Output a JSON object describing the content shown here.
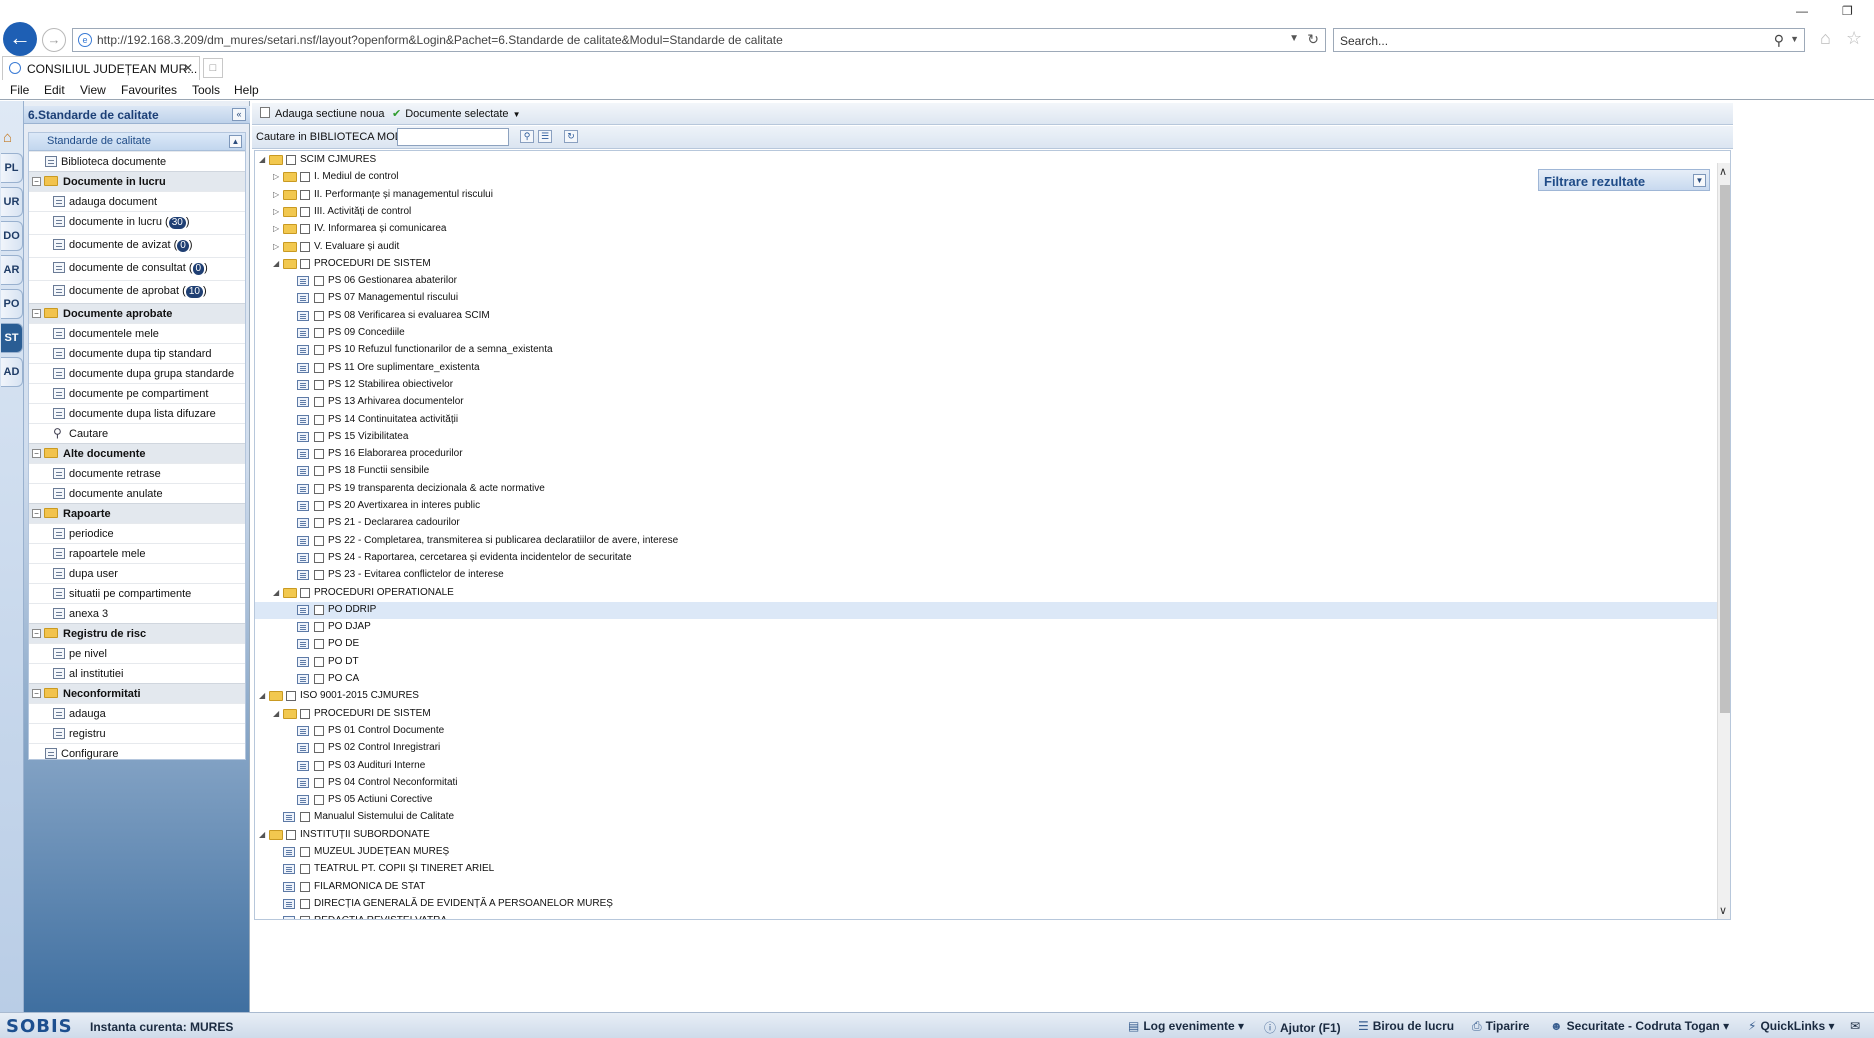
{
  "browser": {
    "url": "http://192.168.3.209/dm_mures/setari.nsf/layout?openform&Login&Pachet=6.Standarde de calitate&Modul=Standarde de calitate",
    "search_placeholder": "Search...",
    "tab_title": "CONSILIUL JUDEȚEAN MUR...",
    "menu": [
      "File",
      "Edit",
      "View",
      "Favourites",
      "Tools",
      "Help"
    ]
  },
  "app": {
    "module_title": "6.Standarde de calitate",
    "side_tabs": [
      "PL",
      "UR",
      "DO",
      "AR",
      "PO",
      "ST",
      "AD"
    ],
    "active_side_tab": "ST",
    "nav_tree_title": "Standarde de calitate",
    "nav": [
      {
        "type": "leaf",
        "label": "Biblioteca documente",
        "indent": 0
      },
      {
        "type": "group",
        "label": "Documente in lucru"
      },
      {
        "type": "leaf",
        "label": "adauga document",
        "indent": 1
      },
      {
        "type": "leaf",
        "label": "documente in lucru",
        "badge": "30",
        "indent": 1
      },
      {
        "type": "leaf",
        "label": "documente de avizat",
        "badge": "0",
        "indent": 1
      },
      {
        "type": "leaf",
        "label": "documente de consultat",
        "badge": "0",
        "indent": 1
      },
      {
        "type": "leaf",
        "label": "documente de aprobat",
        "badge": "10",
        "indent": 1
      },
      {
        "type": "group",
        "label": "Documente aprobate"
      },
      {
        "type": "leaf",
        "label": "documentele mele",
        "indent": 1
      },
      {
        "type": "leaf",
        "label": "documente dupa tip standard",
        "indent": 1
      },
      {
        "type": "leaf",
        "label": "documente dupa grupa standarde",
        "indent": 1
      },
      {
        "type": "leaf",
        "label": "documente pe compartiment",
        "indent": 1
      },
      {
        "type": "leaf",
        "label": "documente dupa lista difuzare",
        "indent": 1
      },
      {
        "type": "search",
        "label": "Cautare",
        "indent": 1
      },
      {
        "type": "group",
        "label": "Alte documente"
      },
      {
        "type": "leaf",
        "label": "documente retrase",
        "indent": 1
      },
      {
        "type": "leaf",
        "label": "documente anulate",
        "indent": 1
      },
      {
        "type": "group",
        "label": "Rapoarte"
      },
      {
        "type": "leaf",
        "label": "periodice",
        "indent": 1
      },
      {
        "type": "leaf",
        "label": "rapoartele mele",
        "indent": 1
      },
      {
        "type": "leaf",
        "label": "dupa user",
        "indent": 1
      },
      {
        "type": "leaf",
        "label": "situatii pe compartimente",
        "indent": 1
      },
      {
        "type": "leaf",
        "label": "anexa 3",
        "indent": 1
      },
      {
        "type": "group",
        "label": "Registru de risc"
      },
      {
        "type": "leaf",
        "label": "pe nivel",
        "indent": 1
      },
      {
        "type": "leaf",
        "label": "al institutiei",
        "indent": 1
      },
      {
        "type": "group",
        "label": "Neconformitati"
      },
      {
        "type": "leaf",
        "label": "adauga",
        "indent": 1
      },
      {
        "type": "leaf",
        "label": "registru",
        "indent": 1
      },
      {
        "type": "leaf",
        "label": "Configurare",
        "indent": 0
      }
    ]
  },
  "content": {
    "toolbar": {
      "add_section": "Adauga sectiune noua",
      "selected_docs": "Documente selectate"
    },
    "search_label": "Cautare in BIBLIOTECA MODEL:",
    "search_value": "",
    "filter_title": "Filtrare rezultate",
    "tree": [
      {
        "label": "SCIM CJMURES",
        "level": 0,
        "kind": "folder",
        "open": true
      },
      {
        "label": "I. Mediul de control",
        "level": 1,
        "kind": "folder",
        "open": false
      },
      {
        "label": "II. Performanțe și managementul riscului",
        "level": 1,
        "kind": "folder",
        "open": false
      },
      {
        "label": "III. Activități de control",
        "level": 1,
        "kind": "folder",
        "open": false
      },
      {
        "label": "IV. Informarea și comunicarea",
        "level": 1,
        "kind": "folder",
        "open": false
      },
      {
        "label": "V. Evaluare și audit",
        "level": 1,
        "kind": "folder",
        "open": false
      },
      {
        "label": "PROCEDURI DE SISTEM",
        "level": 1,
        "kind": "folder",
        "open": true
      },
      {
        "label": "PS 06 Gestionarea abaterilor",
        "level": 2,
        "kind": "doc"
      },
      {
        "label": "PS 07 Managementul riscului",
        "level": 2,
        "kind": "doc"
      },
      {
        "label": "PS 08 Verificarea si evaluarea SCIM",
        "level": 2,
        "kind": "doc"
      },
      {
        "label": "PS 09 Concediile",
        "level": 2,
        "kind": "doc"
      },
      {
        "label": "PS 10 Refuzul functionarilor de a semna_existenta",
        "level": 2,
        "kind": "doc"
      },
      {
        "label": "PS 11 Ore suplimentare_existenta",
        "level": 2,
        "kind": "doc"
      },
      {
        "label": "PS 12 Stabilirea obiectivelor",
        "level": 2,
        "kind": "doc"
      },
      {
        "label": "PS 13 Arhivarea documentelor",
        "level": 2,
        "kind": "doc"
      },
      {
        "label": "PS 14 Continuitatea activității",
        "level": 2,
        "kind": "doc"
      },
      {
        "label": "PS 15 Vizibilitatea",
        "level": 2,
        "kind": "doc"
      },
      {
        "label": "PS 16 Elaborarea procedurilor",
        "level": 2,
        "kind": "doc"
      },
      {
        "label": "PS 18 Functii sensibile",
        "level": 2,
        "kind": "doc"
      },
      {
        "label": "PS 19 transparenta decizionala & acte normative",
        "level": 2,
        "kind": "doc"
      },
      {
        "label": "PS 20 Avertixarea in interes public",
        "level": 2,
        "kind": "doc"
      },
      {
        "label": "PS 21 - Declararea cadourilor",
        "level": 2,
        "kind": "doc"
      },
      {
        "label": "PS 22 - Completarea, transmiterea si publicarea declaratiilor de avere, interese",
        "level": 2,
        "kind": "doc"
      },
      {
        "label": "PS 24 - Raportarea, cercetarea și evidenta incidentelor de securitate",
        "level": 2,
        "kind": "doc"
      },
      {
        "label": "PS 23 - Evitarea conflictelor de interese",
        "level": 2,
        "kind": "doc"
      },
      {
        "label": "PROCEDURI OPERATIONALE",
        "level": 1,
        "kind": "folder",
        "open": true
      },
      {
        "label": "PO DDRIP",
        "level": 2,
        "kind": "doc",
        "selected": true
      },
      {
        "label": "PO DJAP",
        "level": 2,
        "kind": "doc"
      },
      {
        "label": "PO DE",
        "level": 2,
        "kind": "doc"
      },
      {
        "label": "PO DT",
        "level": 2,
        "kind": "doc"
      },
      {
        "label": "PO CA",
        "level": 2,
        "kind": "doc"
      },
      {
        "label": "ISO 9001-2015 CJMURES",
        "level": 0,
        "kind": "folder",
        "open": true
      },
      {
        "label": "PROCEDURI DE SISTEM",
        "level": 1,
        "kind": "folder",
        "open": true
      },
      {
        "label": "PS 01 Control Documente",
        "level": 2,
        "kind": "doc"
      },
      {
        "label": "PS 02 Control Inregistrari",
        "level": 2,
        "kind": "doc"
      },
      {
        "label": "PS 03 Audituri Interne",
        "level": 2,
        "kind": "doc"
      },
      {
        "label": "PS 04 Control Neconformitati",
        "level": 2,
        "kind": "doc"
      },
      {
        "label": "PS 05 Actiuni Corective",
        "level": 2,
        "kind": "doc"
      },
      {
        "label": "Manualul Sistemului de Calitate",
        "level": 1,
        "kind": "doc"
      },
      {
        "label": "INSTITUȚII SUBORDONATE",
        "level": 0,
        "kind": "folder",
        "open": true
      },
      {
        "label": "MUZEUL JUDEȚEAN MUREȘ",
        "level": 1,
        "kind": "doc"
      },
      {
        "label": "TEATRUL PT. COPII ȘI TINERET ARIEL",
        "level": 1,
        "kind": "doc"
      },
      {
        "label": "FILARMONICA DE STAT",
        "level": 1,
        "kind": "doc"
      },
      {
        "label": "DIRECȚIA GENERALĂ DE EVIDENȚĂ A PERSOANELOR MUREȘ",
        "level": 1,
        "kind": "doc"
      },
      {
        "label": "REDACȚIA REVISTEI VATRA",
        "level": 1,
        "kind": "doc"
      }
    ]
  },
  "statusbar": {
    "logo": "SOBIS",
    "instance": "Instanta curenta: MURES",
    "buttons": [
      "Log evenimente",
      "Ajutor (F1)",
      "Birou de lucru",
      "Tiparire",
      "Securitate - Codruta Togan",
      "QuickLinks"
    ]
  }
}
